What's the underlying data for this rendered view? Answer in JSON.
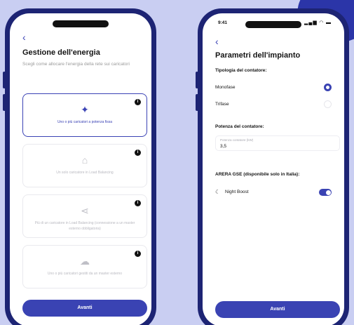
{
  "left_screen": {
    "back_icon": "chevron-left-icon",
    "title": "Gestione dell'energia",
    "subtitle": "Scegli come allocare l'energia della rete sui caricatori",
    "cards": [
      {
        "label": "Uno o più caricatori a potenza fissa",
        "icon": "pin-icon",
        "selected": true
      },
      {
        "label": "Un solo caricatore in Load Balancing",
        "icon": "house-icon",
        "selected": false
      },
      {
        "label": "Più di un caricatore in Load Balancing (connessione a un master esterno obbligatoria)",
        "icon": "share-icon",
        "selected": false
      },
      {
        "label": "Uno o più caricatori gestiti da un master esterno",
        "icon": "cloud-icon",
        "selected": false
      }
    ],
    "info_glyph": "i",
    "next_label": "Avanti"
  },
  "right_screen": {
    "status_time": "9:41",
    "status_icons": "signal-wifi-battery-icons",
    "back_icon": "chevron-left-icon",
    "title": "Parametri dell'impianto",
    "meter_type_label": "Tipologia del contatore:",
    "options": [
      {
        "label": "Monofase",
        "selected": true
      },
      {
        "label": "Trifase",
        "selected": false
      }
    ],
    "power_label": "Potenza del contatore:",
    "power_field_label": "Potenza contatore (kW)",
    "power_value": "3,5",
    "arera_label": "ARERA GSE (disponibile solo in Italia):",
    "night_boost_label": "Night Boost",
    "night_boost_on": true,
    "next_label": "Avanti"
  },
  "colors": {
    "background": "#c9cef2",
    "phone_frame": "#1d2474",
    "accent": "#3a43b3"
  }
}
